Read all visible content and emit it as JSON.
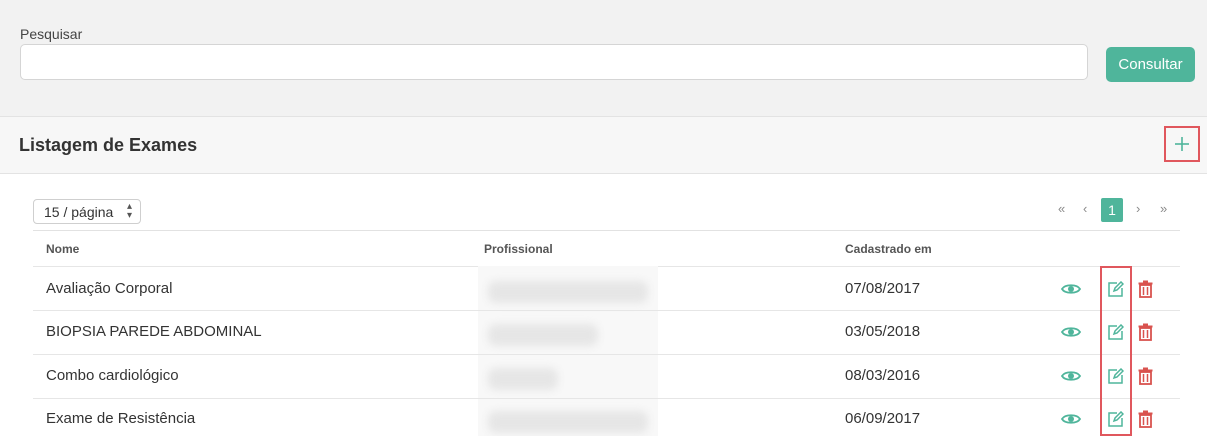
{
  "search": {
    "label": "Pesquisar",
    "value": "",
    "placeholder": "",
    "button_label": "Consultar"
  },
  "list": {
    "title": "Listagem de Exames",
    "per_page": "15 / página",
    "pagination": {
      "first": "«",
      "prev": "‹",
      "current": "1",
      "next": "›",
      "last": "»"
    },
    "columns": [
      "Nome",
      "Profissional",
      "Cadastrado em"
    ],
    "rows": [
      {
        "nome": "Avaliação Corporal",
        "data": "07/08/2017"
      },
      {
        "nome": "BIOPSIA PAREDE ABDOMINAL",
        "data": "03/05/2018"
      },
      {
        "nome": "Combo cardiológico",
        "data": "08/03/2016"
      },
      {
        "nome": "Exame de Resistência",
        "data": "06/09/2017"
      }
    ]
  },
  "colors": {
    "accent": "#4fb59b",
    "danger": "#d9534f",
    "highlight": "#e0575d"
  },
  "icons": {
    "add": "plus-icon",
    "view": "eye-icon",
    "edit": "edit-icon",
    "delete": "trash-icon"
  }
}
